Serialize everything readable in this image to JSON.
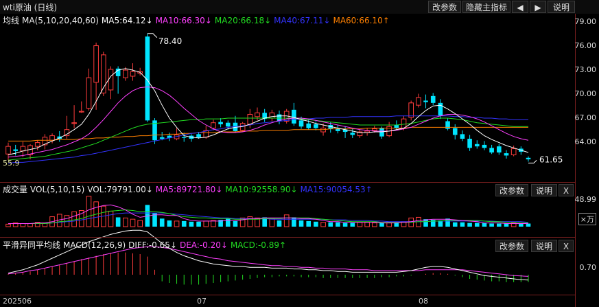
{
  "title": "wti原油 (日线)",
  "toolbar": {
    "modify": "改参数",
    "hide_indicator": "隐藏主指标",
    "prev": "◀",
    "next": "▶",
    "help": "说明"
  },
  "ma_legend": {
    "label": "均线",
    "params": "MA(5,10,20,40,60)",
    "ma5": "MA5:64.12↓",
    "ma10": "MA10:66.30↓",
    "ma20": "MA20:66.18↓",
    "ma40": "MA40:67.11↓",
    "ma60": "MA60:66.10↑"
  },
  "vol_legend": {
    "label": "成交量",
    "params": "VOL(5,10,15)",
    "vol": "VOL:79791.00↓",
    "ma5": "MA5:89721.80↓",
    "ma10": "MA10:92558.90↓",
    "ma15": "MA15:90054.53↑"
  },
  "macd_legend": {
    "label": "平滑异同平均线",
    "params": "MACD(12,26,9)",
    "diff": "DIFF:-0.65↓",
    "dea": "DEA:-0.20↓",
    "macd": "MACD:-0.89↑"
  },
  "panel_buttons": {
    "modify": "改参数",
    "help": "说明",
    "close": "X"
  },
  "price_axis": [
    "79.00",
    "76.00",
    "73.00",
    "70.00",
    "67.00",
    "64.00"
  ],
  "volume_axis": {
    "value": "48.99",
    "unit": "×万"
  },
  "macd_axis": "0.70",
  "date_axis": [
    "202506",
    "07",
    "08"
  ],
  "annotations": {
    "high": "78.40",
    "low": "55.9",
    "last": "61.65"
  },
  "colors": {
    "up": "#ff3c3c",
    "down": "#00e5ff",
    "ma5": "#ffffff",
    "ma10": "#ff40ff",
    "ma20": "#22dd22",
    "ma40": "#3333ff",
    "ma60": "#ff8000",
    "dea": "#ff40ff",
    "macd_neg": "#22dd22"
  },
  "chart_data": {
    "type": "candlestick",
    "ylim": [
      61,
      80
    ],
    "candles": [
      {
        "o": 62.6,
        "c": 63.6,
        "h": 64.1,
        "l": 61.8
      },
      {
        "o": 63.2,
        "c": 63.0,
        "h": 63.8,
        "l": 62.4
      },
      {
        "o": 63.0,
        "c": 63.6,
        "h": 64.2,
        "l": 62.2
      },
      {
        "o": 62.5,
        "c": 63.7,
        "h": 63.9,
        "l": 61.9
      },
      {
        "o": 63.6,
        "c": 64.1,
        "h": 64.4,
        "l": 63.1
      },
      {
        "o": 63.8,
        "c": 64.8,
        "h": 65.2,
        "l": 63.2
      },
      {
        "o": 64.4,
        "c": 65.0,
        "h": 65.3,
        "l": 64.0
      },
      {
        "o": 64.9,
        "c": 64.6,
        "h": 65.6,
        "l": 64.2
      },
      {
        "o": 65.0,
        "c": 65.8,
        "h": 67.6,
        "l": 64.6
      },
      {
        "o": 66.6,
        "c": 66.7,
        "h": 69.0,
        "l": 66.0
      },
      {
        "o": 68.1,
        "c": 68.2,
        "h": 69.5,
        "l": 68.0
      },
      {
        "o": 68.6,
        "c": 72.6,
        "h": 73.8,
        "l": 68.3
      },
      {
        "o": 72.0,
        "c": 76.8,
        "h": 77.2,
        "l": 68.4
      },
      {
        "o": 70.6,
        "c": 75.6,
        "h": 76.0,
        "l": 70.2
      },
      {
        "o": 71.0,
        "c": 73.7,
        "h": 74.1,
        "l": 69.8
      },
      {
        "o": 73.8,
        "c": 72.8,
        "h": 74.1,
        "l": 70.5
      },
      {
        "o": 72.6,
        "c": 73.6,
        "h": 74.0,
        "l": 72.2
      },
      {
        "o": 72.8,
        "c": 73.4,
        "h": 74.5,
        "l": 72.2
      },
      {
        "o": 73.2,
        "c": 73.4,
        "h": 73.9,
        "l": 72.9
      },
      {
        "o": 78.0,
        "c": 67.0,
        "h": 78.4,
        "l": 66.8
      },
      {
        "o": 67.0,
        "c": 64.4,
        "h": 67.3,
        "l": 63.9
      },
      {
        "o": 64.8,
        "c": 64.6,
        "h": 65.5,
        "l": 64.4
      },
      {
        "o": 65.0,
        "c": 64.7,
        "h": 65.4,
        "l": 64.3
      },
      {
        "o": 64.6,
        "c": 65.1,
        "h": 66.0,
        "l": 64.4
      },
      {
        "o": 64.8,
        "c": 64.7,
        "h": 65.4,
        "l": 64.2
      },
      {
        "o": 65.0,
        "c": 64.6,
        "h": 65.2,
        "l": 64.2
      },
      {
        "o": 65.2,
        "c": 64.8,
        "h": 65.5,
        "l": 64.6
      },
      {
        "o": 64.8,
        "c": 65.7,
        "h": 66.3,
        "l": 64.6
      },
      {
        "o": 66.0,
        "c": 66.7,
        "h": 67.1,
        "l": 65.7
      },
      {
        "o": 66.8,
        "c": 66.5,
        "h": 67.3,
        "l": 66.1
      },
      {
        "o": 66.7,
        "c": 66.2,
        "h": 67.0,
        "l": 65.8
      },
      {
        "o": 66.7,
        "c": 65.6,
        "h": 67.6,
        "l": 65.4
      },
      {
        "o": 65.7,
        "c": 66.6,
        "h": 66.8,
        "l": 65.5
      },
      {
        "o": 66.5,
        "c": 67.8,
        "h": 68.5,
        "l": 66.0
      },
      {
        "o": 67.5,
        "c": 68.0,
        "h": 68.7,
        "l": 67.0
      },
      {
        "o": 68.0,
        "c": 67.2,
        "h": 68.5,
        "l": 66.8
      },
      {
        "o": 67.3,
        "c": 68.0,
        "h": 68.4,
        "l": 66.9
      },
      {
        "o": 67.8,
        "c": 66.9,
        "h": 68.3,
        "l": 66.5
      },
      {
        "o": 66.9,
        "c": 68.2,
        "h": 68.5,
        "l": 66.6
      },
      {
        "o": 68.4,
        "c": 66.6,
        "h": 69.3,
        "l": 66.3
      },
      {
        "o": 67.0,
        "c": 66.2,
        "h": 67.5,
        "l": 65.9
      },
      {
        "o": 66.6,
        "c": 66.0,
        "h": 67.2,
        "l": 65.8
      },
      {
        "o": 66.5,
        "c": 66.0,
        "h": 66.9,
        "l": 65.7
      },
      {
        "o": 65.5,
        "c": 66.0,
        "h": 66.6,
        "l": 65.0
      },
      {
        "o": 66.4,
        "c": 65.9,
        "h": 66.8,
        "l": 65.4
      },
      {
        "o": 65.9,
        "c": 65.6,
        "h": 66.4,
        "l": 65.3
      },
      {
        "o": 65.8,
        "c": 65.5,
        "h": 66.2,
        "l": 64.7
      },
      {
        "o": 65.4,
        "c": 65.1,
        "h": 65.9,
        "l": 64.7
      },
      {
        "o": 65.0,
        "c": 65.5,
        "h": 65.8,
        "l": 64.7
      },
      {
        "o": 65.4,
        "c": 65.6,
        "h": 66.0,
        "l": 65.0
      },
      {
        "o": 65.7,
        "c": 65.9,
        "h": 66.3,
        "l": 65.4
      },
      {
        "o": 66.0,
        "c": 64.9,
        "h": 66.2,
        "l": 64.6
      },
      {
        "o": 65.0,
        "c": 66.2,
        "h": 66.8,
        "l": 64.8
      },
      {
        "o": 66.4,
        "c": 66.0,
        "h": 67.0,
        "l": 65.8
      },
      {
        "o": 66.0,
        "c": 67.2,
        "h": 67.6,
        "l": 65.7
      },
      {
        "o": 67.4,
        "c": 69.3,
        "h": 69.6,
        "l": 67.0
      },
      {
        "o": 69.0,
        "c": 70.0,
        "h": 70.5,
        "l": 68.7
      },
      {
        "o": 69.6,
        "c": 69.4,
        "h": 70.4,
        "l": 68.6
      },
      {
        "o": 70.2,
        "c": 69.3,
        "h": 70.6,
        "l": 69.0
      },
      {
        "o": 69.3,
        "c": 67.6,
        "h": 69.8,
        "l": 67.2
      },
      {
        "o": 66.9,
        "c": 65.9,
        "h": 67.3,
        "l": 65.7
      },
      {
        "o": 66.0,
        "c": 65.1,
        "h": 66.5,
        "l": 64.5
      },
      {
        "o": 65.2,
        "c": 64.6,
        "h": 65.7,
        "l": 64.3
      },
      {
        "o": 64.6,
        "c": 63.4,
        "h": 65.1,
        "l": 63.0
      },
      {
        "o": 63.9,
        "c": 63.6,
        "h": 64.4,
        "l": 63.3
      },
      {
        "o": 63.8,
        "c": 63.4,
        "h": 64.3,
        "l": 63.1
      },
      {
        "o": 63.4,
        "c": 62.8,
        "h": 63.8,
        "l": 62.6
      },
      {
        "o": 63.6,
        "c": 62.8,
        "h": 63.9,
        "l": 62.5
      },
      {
        "o": 62.7,
        "c": 62.4,
        "h": 63.1,
        "l": 62.0
      },
      {
        "o": 62.5,
        "c": 63.3,
        "h": 63.7,
        "l": 62.3
      },
      {
        "o": 63.3,
        "c": 62.9,
        "h": 63.6,
        "l": 62.5
      },
      {
        "o": 62.1,
        "c": 61.9,
        "h": 62.3,
        "l": 61.6
      }
    ],
    "ma5": [
      62.5,
      62.7,
      63.0,
      63.2,
      63.4,
      63.9,
      64.3,
      64.7,
      65.2,
      65.8,
      66.5,
      67.8,
      69.5,
      71.3,
      72.8,
      73.6,
      73.8,
      73.6,
      73.3,
      72.3,
      70.9,
      69.0,
      67.3,
      66.1,
      65.0,
      64.8,
      64.7,
      64.8,
      65.1,
      65.5,
      65.9,
      66.1,
      66.2,
      66.5,
      66.9,
      67.3,
      67.5,
      67.6,
      67.6,
      67.4,
      67.1,
      66.9,
      66.6,
      66.4,
      66.2,
      66.0,
      65.8,
      65.6,
      65.4,
      65.4,
      65.5,
      65.5,
      65.6,
      65.8,
      66.0,
      66.6,
      67.5,
      68.3,
      68.9,
      69.0,
      68.5,
      67.9,
      67.2,
      66.5,
      65.7,
      65.0,
      64.5,
      64.1,
      63.7,
      63.4,
      63.1,
      62.8
    ],
    "ma10": [
      62.2,
      62.3,
      62.4,
      62.6,
      62.8,
      63.0,
      63.2,
      63.5,
      63.8,
      64.2,
      64.6,
      65.2,
      66.1,
      67.1,
      68.2,
      69.3,
      70.2,
      70.9,
      71.3,
      71.4,
      71.3,
      70.9,
      70.3,
      69.5,
      68.6,
      67.8,
      67.0,
      66.4,
      65.9,
      65.5,
      65.4,
      65.4,
      65.5,
      65.7,
      66.0,
      66.4,
      66.7,
      67.0,
      67.2,
      67.3,
      67.3,
      67.2,
      67.0,
      66.8,
      66.6,
      66.4,
      66.2,
      66.0,
      65.8,
      65.7,
      65.6,
      65.6,
      65.6,
      65.7,
      65.9,
      66.1,
      66.5,
      66.9,
      67.3,
      67.6,
      67.8,
      67.8,
      67.7,
      67.5,
      67.2,
      66.8,
      66.3,
      65.8,
      65.3,
      64.9,
      64.6,
      64.4
    ],
    "ma20": [
      61.8,
      61.9,
      62.0,
      62.1,
      62.2,
      62.3,
      62.5,
      62.7,
      62.9,
      63.1,
      63.4,
      63.7,
      64.0,
      64.4,
      64.8,
      65.2,
      65.6,
      66.0,
      66.3,
      66.5,
      66.6,
      66.7,
      66.8,
      66.9,
      67.0,
      67.1,
      67.1,
      67.2,
      67.2,
      67.2,
      67.3,
      67.3,
      67.3,
      67.3,
      67.3,
      67.3,
      67.3,
      67.3,
      67.3,
      67.3,
      67.2,
      67.1,
      67.0,
      66.9,
      66.8,
      66.7,
      66.6,
      66.5,
      66.4,
      66.4,
      66.4,
      66.4,
      66.4,
      66.4,
      66.5,
      66.6,
      66.8,
      67.0,
      67.2,
      67.3,
      67.3,
      67.2,
      67.1,
      66.9,
      66.7,
      66.6,
      66.5,
      66.4,
      66.3,
      66.2,
      66.2,
      66.2
    ],
    "ma40": [
      61.4,
      61.5,
      61.5,
      61.6,
      61.7,
      61.8,
      61.9,
      62.0,
      62.1,
      62.2,
      62.4,
      62.5,
      62.7,
      62.9,
      63.1,
      63.3,
      63.5,
      63.7,
      63.9,
      64.1,
      64.3,
      64.5,
      64.7,
      64.9,
      65.1,
      65.3,
      65.4,
      65.6,
      65.8,
      65.9,
      66.1,
      66.2,
      66.3,
      66.4,
      66.6,
      66.7,
      66.8,
      66.9,
      67.0,
      67.1,
      67.2,
      67.2,
      67.3,
      67.3,
      67.4,
      67.4,
      67.4,
      67.5,
      67.5,
      67.5,
      67.5,
      67.5,
      67.5,
      67.6,
      67.6,
      67.6,
      67.6,
      67.6,
      67.6,
      67.6,
      67.6,
      67.5,
      67.5,
      67.4,
      67.4,
      67.3,
      67.3,
      67.2,
      67.2,
      67.1,
      67.1,
      67.1
    ],
    "ma60": [
      64.3,
      64.3,
      64.3,
      64.3,
      64.4,
      64.4,
      64.4,
      64.5,
      64.5,
      64.5,
      64.6,
      64.6,
      64.7,
      64.7,
      64.8,
      64.8,
      64.9,
      64.9,
      65.0,
      65.0,
      65.1,
      65.1,
      65.2,
      65.2,
      65.3,
      65.3,
      65.4,
      65.4,
      65.4,
      65.5,
      65.5,
      65.5,
      65.6,
      65.6,
      65.6,
      65.7,
      65.7,
      65.7,
      65.7,
      65.8,
      65.8,
      65.8,
      65.8,
      65.8,
      65.9,
      65.9,
      65.9,
      65.9,
      65.9,
      66.0,
      66.0,
      66.0,
      66.0,
      66.0,
      66.0,
      66.1,
      66.1,
      66.1,
      66.1,
      66.1,
      66.1,
      66.1,
      66.1,
      66.1,
      66.1,
      66.1,
      66.1,
      66.1,
      66.1,
      66.1,
      66.1,
      66.1
    ],
    "volume": [
      4,
      6,
      5,
      5,
      7,
      6,
      16,
      20,
      18,
      24,
      26,
      49,
      40,
      33,
      25,
      15,
      14,
      12,
      10,
      35,
      22,
      13,
      10,
      9,
      9,
      8,
      8,
      9,
      10,
      11,
      13,
      9,
      14,
      16,
      14,
      15,
      13,
      10,
      19,
      15,
      10,
      9,
      8,
      7,
      7,
      7,
      6,
      6,
      7,
      7,
      6,
      6,
      6,
      7,
      8,
      14,
      15,
      12,
      11,
      10,
      13,
      7,
      7,
      6,
      6,
      6,
      5,
      5,
      5,
      6,
      6,
      5
    ],
    "volume_up": [
      1,
      1,
      1,
      1,
      1,
      1,
      1,
      1,
      1,
      1,
      1,
      1,
      1,
      1,
      1,
      0,
      1,
      1,
      1,
      0,
      0,
      0,
      0,
      1,
      0,
      0,
      0,
      1,
      1,
      0,
      0,
      0,
      1,
      1,
      1,
      0,
      1,
      0,
      1,
      0,
      0,
      0,
      0,
      1,
      0,
      0,
      0,
      0,
      1,
      1,
      1,
      0,
      1,
      0,
      1,
      1,
      1,
      0,
      0,
      0,
      0,
      0,
      0,
      0,
      0,
      0,
      0,
      0,
      0,
      1,
      0,
      0
    ],
    "vol_ma5": [
      5,
      5,
      5,
      5,
      6,
      6,
      8,
      11,
      13,
      17,
      21,
      27,
      31,
      34,
      35,
      32,
      27,
      20,
      15,
      17,
      19,
      19,
      18,
      18,
      13,
      10,
      9,
      9,
      9,
      9,
      10,
      10,
      11,
      13,
      13,
      14,
      14,
      14,
      14,
      14,
      13,
      13,
      12,
      10,
      8,
      8,
      7,
      7,
      7,
      7,
      7,
      6,
      6,
      6,
      7,
      8,
      10,
      11,
      12,
      12,
      12,
      11,
      10,
      9,
      8,
      6,
      6,
      6,
      5,
      5,
      5,
      5
    ],
    "vol_ma10": [
      5,
      5,
      5,
      5,
      5,
      5,
      6,
      8,
      9,
      11,
      13,
      17,
      20,
      23,
      25,
      26,
      27,
      26,
      24,
      25,
      24,
      23,
      21,
      18,
      16,
      15,
      14,
      14,
      13,
      13,
      13,
      12,
      12,
      12,
      12,
      13,
      13,
      13,
      14,
      14,
      14,
      14,
      13,
      12,
      11,
      10,
      9,
      8,
      8,
      8,
      8,
      7,
      7,
      7,
      7,
      7,
      8,
      8,
      9,
      9,
      10,
      10,
      10,
      10,
      10,
      9,
      8,
      8,
      7,
      7,
      6,
      6
    ],
    "vol_ma15": [
      5,
      5,
      5,
      5,
      5,
      5,
      6,
      7,
      8,
      9,
      11,
      13,
      15,
      17,
      19,
      21,
      22,
      22,
      22,
      22,
      22,
      22,
      21,
      20,
      19,
      18,
      17,
      16,
      15,
      14,
      14,
      13,
      13,
      13,
      13,
      13,
      12,
      12,
      12,
      12,
      12,
      12,
      12,
      12,
      11,
      11,
      11,
      10,
      10,
      10,
      9,
      9,
      8,
      8,
      8,
      8,
      8,
      8,
      9,
      9,
      9,
      9,
      9,
      9,
      9,
      9,
      9,
      8,
      8,
      8,
      8,
      7
    ],
    "macd_hist": [
      0.1,
      0.2,
      0.3,
      0.4,
      0.6,
      0.8,
      1.0,
      1.2,
      1.4,
      1.6,
      1.9,
      2.1,
      2.3,
      2.5,
      2.6,
      2.7,
      2.7,
      2.6,
      2.5,
      2.2,
      0.6,
      -0.8,
      -1.0,
      -1.1,
      -1.2,
      -1.2,
      -1.2,
      -1.1,
      -1.0,
      -0.9,
      -0.8,
      -0.7,
      -0.6,
      -0.5,
      -0.4,
      -0.3,
      -0.3,
      -0.2,
      -0.2,
      -0.2,
      -0.3,
      -0.3,
      -0.3,
      -0.4,
      -0.4,
      -0.4,
      -0.4,
      -0.4,
      -0.4,
      -0.4,
      -0.4,
      -0.3,
      -0.3,
      -0.2,
      -0.2,
      -0.1,
      0.0,
      0.1,
      0.2,
      0.2,
      0.1,
      -0.1,
      -0.3,
      -0.5,
      -0.6,
      -0.7,
      -0.8,
      -0.8,
      -0.9,
      -0.9,
      -0.9,
      -0.89
    ],
    "macd_diff": [
      0.2,
      0.4,
      0.6,
      0.9,
      1.2,
      1.6,
      2.0,
      2.4,
      2.8,
      3.2,
      3.6,
      4.0,
      4.3,
      4.6,
      4.9,
      5.1,
      5.3,
      5.4,
      5.4,
      5.2,
      4.5,
      3.8,
      3.2,
      2.7,
      2.3,
      2.0,
      1.7,
      1.5,
      1.3,
      1.2,
      1.1,
      1.0,
      1.0,
      0.9,
      0.9,
      0.9,
      0.8,
      0.8,
      0.8,
      0.7,
      0.7,
      0.6,
      0.6,
      0.5,
      0.5,
      0.4,
      0.4,
      0.3,
      0.3,
      0.3,
      0.3,
      0.3,
      0.3,
      0.3,
      0.4,
      0.5,
      0.7,
      0.9,
      1.0,
      1.0,
      0.9,
      0.7,
      0.5,
      0.3,
      0.1,
      -0.1,
      -0.2,
      -0.3,
      -0.4,
      -0.5,
      -0.6,
      -0.65
    ],
    "macd_dea": [
      0.1,
      0.2,
      0.3,
      0.5,
      0.6,
      0.8,
      1.0,
      1.2,
      1.4,
      1.6,
      1.8,
      2.0,
      2.2,
      2.4,
      2.6,
      2.8,
      3.0,
      3.2,
      3.3,
      3.4,
      3.4,
      3.3,
      3.2,
      3.0,
      2.8,
      2.6,
      2.4,
      2.2,
      2.0,
      1.9,
      1.7,
      1.6,
      1.5,
      1.4,
      1.3,
      1.2,
      1.1,
      1.1,
      1.0,
      1.0,
      0.9,
      0.9,
      0.8,
      0.8,
      0.7,
      0.7,
      0.7,
      0.6,
      0.6,
      0.6,
      0.5,
      0.5,
      0.5,
      0.5,
      0.5,
      0.5,
      0.5,
      0.6,
      0.6,
      0.6,
      0.6,
      0.6,
      0.6,
      0.5,
      0.4,
      0.3,
      0.2,
      0.1,
      0.0,
      -0.1,
      -0.15,
      -0.2
    ]
  }
}
